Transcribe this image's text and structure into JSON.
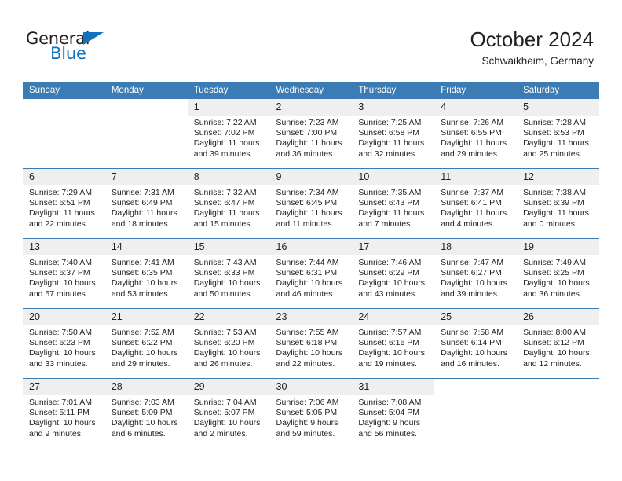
{
  "brand": {
    "word1": "General",
    "word2": "Blue",
    "triangle_color": "#1272bb",
    "text_color": "#231f20"
  },
  "header": {
    "title": "October 2024",
    "subtitle": "Schwaikheim, Germany",
    "accent_color": "#3c7cb5",
    "band_color": "#efefef"
  },
  "calendar": {
    "weekday_headers": [
      "Sunday",
      "Monday",
      "Tuesday",
      "Wednesday",
      "Thursday",
      "Friday",
      "Saturday"
    ],
    "weeks": [
      [
        {
          "day": "",
          "type": "blank",
          "lines": []
        },
        {
          "day": "",
          "type": "blank",
          "lines": []
        },
        {
          "day": "1",
          "type": "filled",
          "lines": [
            "Sunrise: 7:22 AM",
            "Sunset: 7:02 PM",
            "Daylight: 11 hours",
            "and 39 minutes."
          ]
        },
        {
          "day": "2",
          "type": "filled",
          "lines": [
            "Sunrise: 7:23 AM",
            "Sunset: 7:00 PM",
            "Daylight: 11 hours",
            "and 36 minutes."
          ]
        },
        {
          "day": "3",
          "type": "filled",
          "lines": [
            "Sunrise: 7:25 AM",
            "Sunset: 6:58 PM",
            "Daylight: 11 hours",
            "and 32 minutes."
          ]
        },
        {
          "day": "4",
          "type": "filled",
          "lines": [
            "Sunrise: 7:26 AM",
            "Sunset: 6:55 PM",
            "Daylight: 11 hours",
            "and 29 minutes."
          ]
        },
        {
          "day": "5",
          "type": "filled",
          "lines": [
            "Sunrise: 7:28 AM",
            "Sunset: 6:53 PM",
            "Daylight: 11 hours",
            "and 25 minutes."
          ]
        }
      ],
      [
        {
          "day": "6",
          "type": "filled",
          "lines": [
            "Sunrise: 7:29 AM",
            "Sunset: 6:51 PM",
            "Daylight: 11 hours",
            "and 22 minutes."
          ]
        },
        {
          "day": "7",
          "type": "filled",
          "lines": [
            "Sunrise: 7:31 AM",
            "Sunset: 6:49 PM",
            "Daylight: 11 hours",
            "and 18 minutes."
          ]
        },
        {
          "day": "8",
          "type": "filled",
          "lines": [
            "Sunrise: 7:32 AM",
            "Sunset: 6:47 PM",
            "Daylight: 11 hours",
            "and 15 minutes."
          ]
        },
        {
          "day": "9",
          "type": "filled",
          "lines": [
            "Sunrise: 7:34 AM",
            "Sunset: 6:45 PM",
            "Daylight: 11 hours",
            "and 11 minutes."
          ]
        },
        {
          "day": "10",
          "type": "filled",
          "lines": [
            "Sunrise: 7:35 AM",
            "Sunset: 6:43 PM",
            "Daylight: 11 hours",
            "and 7 minutes."
          ]
        },
        {
          "day": "11",
          "type": "filled",
          "lines": [
            "Sunrise: 7:37 AM",
            "Sunset: 6:41 PM",
            "Daylight: 11 hours",
            "and 4 minutes."
          ]
        },
        {
          "day": "12",
          "type": "filled",
          "lines": [
            "Sunrise: 7:38 AM",
            "Sunset: 6:39 PM",
            "Daylight: 11 hours",
            "and 0 minutes."
          ]
        }
      ],
      [
        {
          "day": "13",
          "type": "filled",
          "lines": [
            "Sunrise: 7:40 AM",
            "Sunset: 6:37 PM",
            "Daylight: 10 hours",
            "and 57 minutes."
          ]
        },
        {
          "day": "14",
          "type": "filled",
          "lines": [
            "Sunrise: 7:41 AM",
            "Sunset: 6:35 PM",
            "Daylight: 10 hours",
            "and 53 minutes."
          ]
        },
        {
          "day": "15",
          "type": "filled",
          "lines": [
            "Sunrise: 7:43 AM",
            "Sunset: 6:33 PM",
            "Daylight: 10 hours",
            "and 50 minutes."
          ]
        },
        {
          "day": "16",
          "type": "filled",
          "lines": [
            "Sunrise: 7:44 AM",
            "Sunset: 6:31 PM",
            "Daylight: 10 hours",
            "and 46 minutes."
          ]
        },
        {
          "day": "17",
          "type": "filled",
          "lines": [
            "Sunrise: 7:46 AM",
            "Sunset: 6:29 PM",
            "Daylight: 10 hours",
            "and 43 minutes."
          ]
        },
        {
          "day": "18",
          "type": "filled",
          "lines": [
            "Sunrise: 7:47 AM",
            "Sunset: 6:27 PM",
            "Daylight: 10 hours",
            "and 39 minutes."
          ]
        },
        {
          "day": "19",
          "type": "filled",
          "lines": [
            "Sunrise: 7:49 AM",
            "Sunset: 6:25 PM",
            "Daylight: 10 hours",
            "and 36 minutes."
          ]
        }
      ],
      [
        {
          "day": "20",
          "type": "filled",
          "lines": [
            "Sunrise: 7:50 AM",
            "Sunset: 6:23 PM",
            "Daylight: 10 hours",
            "and 33 minutes."
          ]
        },
        {
          "day": "21",
          "type": "filled",
          "lines": [
            "Sunrise: 7:52 AM",
            "Sunset: 6:22 PM",
            "Daylight: 10 hours",
            "and 29 minutes."
          ]
        },
        {
          "day": "22",
          "type": "filled",
          "lines": [
            "Sunrise: 7:53 AM",
            "Sunset: 6:20 PM",
            "Daylight: 10 hours",
            "and 26 minutes."
          ]
        },
        {
          "day": "23",
          "type": "filled",
          "lines": [
            "Sunrise: 7:55 AM",
            "Sunset: 6:18 PM",
            "Daylight: 10 hours",
            "and 22 minutes."
          ]
        },
        {
          "day": "24",
          "type": "filled",
          "lines": [
            "Sunrise: 7:57 AM",
            "Sunset: 6:16 PM",
            "Daylight: 10 hours",
            "and 19 minutes."
          ]
        },
        {
          "day": "25",
          "type": "filled",
          "lines": [
            "Sunrise: 7:58 AM",
            "Sunset: 6:14 PM",
            "Daylight: 10 hours",
            "and 16 minutes."
          ]
        },
        {
          "day": "26",
          "type": "filled",
          "lines": [
            "Sunrise: 8:00 AM",
            "Sunset: 6:12 PM",
            "Daylight: 10 hours",
            "and 12 minutes."
          ]
        }
      ],
      [
        {
          "day": "27",
          "type": "filled",
          "lines": [
            "Sunrise: 7:01 AM",
            "Sunset: 5:11 PM",
            "Daylight: 10 hours",
            "and 9 minutes."
          ]
        },
        {
          "day": "28",
          "type": "filled",
          "lines": [
            "Sunrise: 7:03 AM",
            "Sunset: 5:09 PM",
            "Daylight: 10 hours",
            "and 6 minutes."
          ]
        },
        {
          "day": "29",
          "type": "filled",
          "lines": [
            "Sunrise: 7:04 AM",
            "Sunset: 5:07 PM",
            "Daylight: 10 hours",
            "and 2 minutes."
          ]
        },
        {
          "day": "30",
          "type": "filled",
          "lines": [
            "Sunrise: 7:06 AM",
            "Sunset: 5:05 PM",
            "Daylight: 9 hours",
            "and 59 minutes."
          ]
        },
        {
          "day": "31",
          "type": "filled",
          "lines": [
            "Sunrise: 7:08 AM",
            "Sunset: 5:04 PM",
            "Daylight: 9 hours",
            "and 56 minutes."
          ]
        },
        {
          "day": "",
          "type": "blank",
          "lines": []
        },
        {
          "day": "",
          "type": "blank",
          "lines": []
        }
      ]
    ]
  }
}
